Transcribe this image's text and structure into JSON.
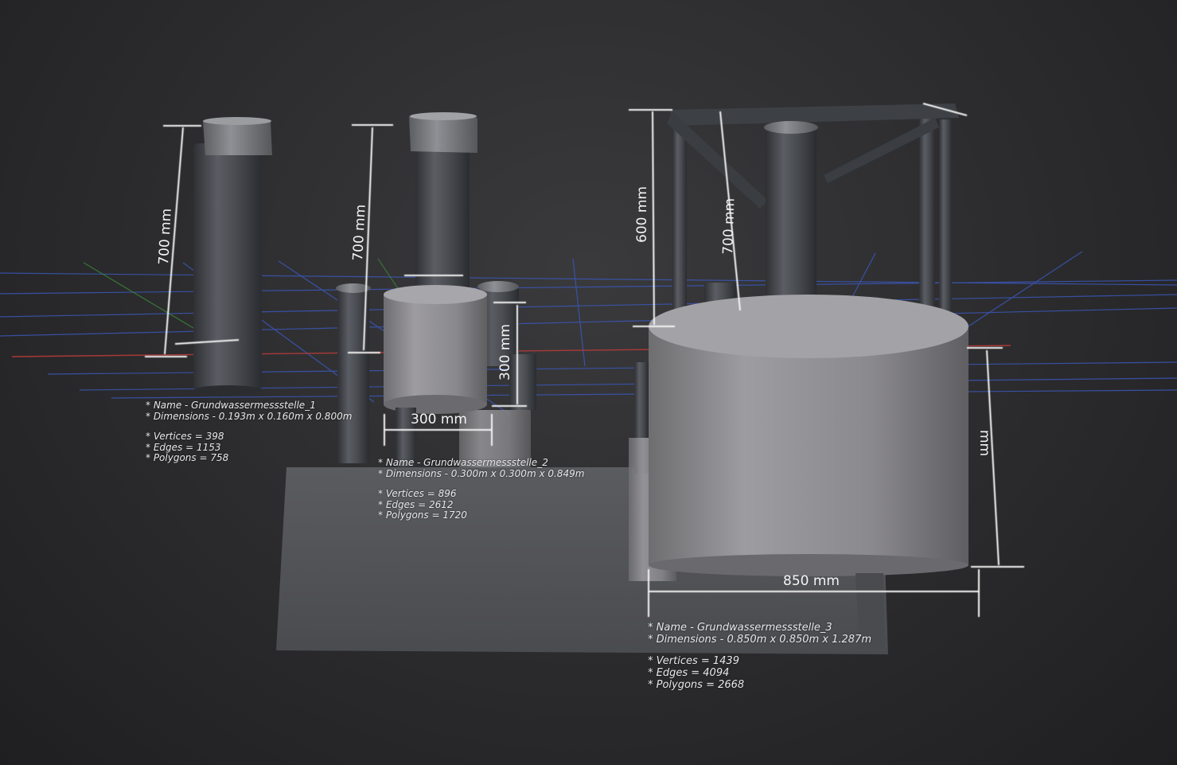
{
  "models": [
    {
      "name": "* Name - Grundwassermessstelle_1",
      "dimensions": "* Dimensions -  0.193m x 0.160m x 0.800m",
      "vertices": "* Vertices = 398",
      "edges": "* Edges = 1153",
      "polygons": "* Polygons = 758",
      "height_label": "700 mm"
    },
    {
      "name": "* Name - Grundwassermessstelle_2",
      "dimensions": "* Dimensions -  0.300m x 0.300m x 0.849m",
      "vertices": "* Vertices = 896",
      "edges": "* Edges = 2612",
      "polygons": "* Polygons = 1720",
      "height_label": "700 mm",
      "base_height_label": "300 mm",
      "base_width_label": "300 mm"
    },
    {
      "name": "* Name - Grundwassermessstelle_3",
      "dimensions": "* Dimensions -  0.850m x 0.850m x 1.287m",
      "vertices": "* Vertices = 1439",
      "edges": "* Edges = 4094",
      "polygons": "* Polygons = 2668",
      "frame_height_label": "600 mm",
      "pipe_height_label": "700 mm",
      "base_width_label": "850 mm",
      "side_label": "mm"
    }
  ],
  "colors": {
    "background": "#2b2b2d",
    "concrete": "#8c8b8f",
    "pipe": "#4a4d52",
    "grid_blue": "#3a57b8",
    "axis_red": "#b83a3a",
    "axis_green": "#3a8a3a",
    "dimension_line": "#f4f4f4"
  }
}
